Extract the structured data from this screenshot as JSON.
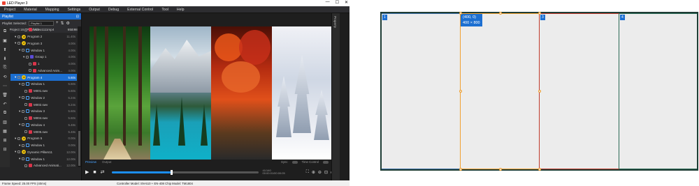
{
  "app": {
    "title": "LED Player 3",
    "window_controls": [
      "—",
      "☐",
      "✕"
    ],
    "menu": [
      "Project",
      "Material",
      "Mapping",
      "Settings",
      "Output",
      "Debug",
      "External Control",
      "Tool",
      "Help"
    ]
  },
  "playlist_panel": {
    "header": "Playlist",
    "pin": "⊡",
    "selected_label": "Playlist Selected:",
    "selected_value": "Playlist 1",
    "project_name": "New Project 16 - Playlist 1",
    "project_duration": "944.68s"
  },
  "tree": [
    {
      "type": "media",
      "label": "Video1111mp4",
      "dur": "7.00s",
      "indent": 3
    },
    {
      "type": "prog",
      "badge": "18",
      "label": "Program 2",
      "dur": "11.40s",
      "indent": 1
    },
    {
      "type": "prog",
      "badge": "17",
      "label": "Program 3",
      "dur": "4.00s",
      "indent": 1
    },
    {
      "type": "win",
      "label": "Window 1",
      "dur": "4.00s",
      "indent": 2
    },
    {
      "type": "grp",
      "label": "Group 1",
      "dur": "4.00s",
      "indent": 3
    },
    {
      "type": "media",
      "label": "1",
      "dur": "4.00s",
      "indent": 4
    },
    {
      "type": "media",
      "label": "Advanced Anim...",
      "dur": "4.00s",
      "indent": 4
    },
    {
      "type": "prog",
      "badge": "16",
      "label": "Program 4",
      "dur": "5.60s",
      "indent": 1,
      "selected": true
    },
    {
      "type": "win",
      "label": "Window 1",
      "dur": "5.60s",
      "indent": 2
    },
    {
      "type": "media",
      "label": "M001.swv",
      "dur": "5.60s",
      "indent": 3
    },
    {
      "type": "win",
      "label": "Window 2",
      "dur": "5.24s",
      "indent": 2
    },
    {
      "type": "media",
      "label": "M002.swv",
      "dur": "5.24s",
      "indent": 3
    },
    {
      "type": "win",
      "label": "Window 3",
      "dur": "5.60s",
      "indent": 2
    },
    {
      "type": "media",
      "label": "M004.swv",
      "dur": "5.60s",
      "indent": 3
    },
    {
      "type": "win",
      "label": "Window 4",
      "dur": "5.48s",
      "indent": 2
    },
    {
      "type": "media",
      "label": "M005.swv",
      "dur": "5.48s",
      "indent": 3
    },
    {
      "type": "prog",
      "badge": "15",
      "label": "Program 5",
      "dur": "0.00s",
      "indent": 1
    },
    {
      "type": "win",
      "label": "Window 1",
      "dur": "0.00s",
      "indent": 2
    },
    {
      "type": "prog",
      "badge": "20",
      "label": "Dynamic Pillars11",
      "dur": "12.00s",
      "indent": 1
    },
    {
      "type": "win",
      "label": "Window 1",
      "dur": "12.00s",
      "indent": 2
    },
    {
      "type": "media",
      "label": "Advanced Animati...",
      "dur": "12.00s",
      "indent": 3
    }
  ],
  "toolstrip": [
    "⧉",
    "▣",
    "⬆",
    "⬇",
    "⎘",
    "⟲",
    "⋯",
    "🗑",
    "↶",
    "⧉",
    "▥",
    "▦",
    "⊞",
    "⊟"
  ],
  "preview": {
    "side_tab": "Property",
    "tabs": [
      "Preview",
      "Output"
    ],
    "toggle_sync": "Sync",
    "toggle_timecontrol": "Time Control",
    "time_top": "41/140",
    "time_bottom": "00:00:01/00:00:05",
    "zoom": "60%",
    "progress": 0.4
  },
  "status": {
    "frame_speed": "Frame Speed: 25.00 FPS (40ms)",
    "controller": "Controller Model: SN-510 + EN-408   Chip Model: TM1804"
  },
  "layout": {
    "regions": [
      {
        "num": "1",
        "border": "#3b6ea5"
      },
      {
        "num": "2",
        "border": "#f0a030"
      },
      {
        "num": "3",
        "border": "#c0392b"
      },
      {
        "num": "4",
        "border": "#2b6a55"
      }
    ],
    "coord_line1": "(400, 0)",
    "coord_line2": "400 × 800"
  }
}
